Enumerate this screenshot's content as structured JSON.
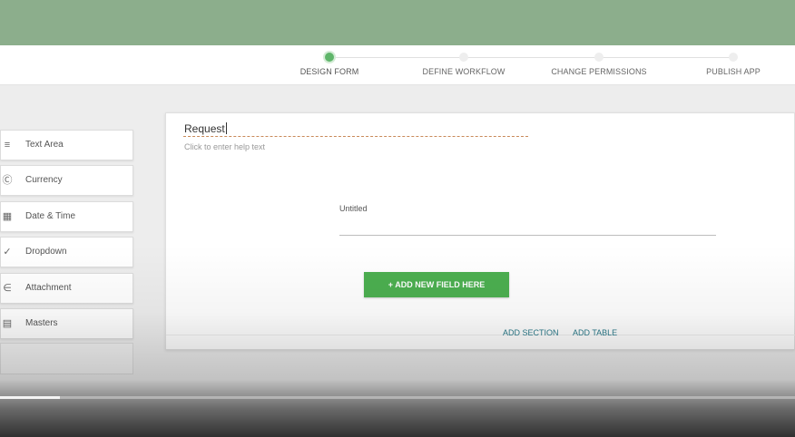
{
  "app": {
    "header_color": "#8cae8c",
    "accent": "#4caf50"
  },
  "stepper": {
    "steps": [
      {
        "label": "DESIGN FORM",
        "active": true
      },
      {
        "label": "DEFINE WORKFLOW",
        "active": false
      },
      {
        "label": "CHANGE PERMISSIONS",
        "active": false
      },
      {
        "label": "PUBLISH APP",
        "active": false
      }
    ]
  },
  "palette": {
    "items": [
      {
        "label": "Text Area",
        "icon": "text-area-icon"
      },
      {
        "label": "Currency",
        "icon": "currency-icon"
      },
      {
        "label": "Date & Time",
        "icon": "calendar-icon"
      },
      {
        "label": "Dropdown",
        "icon": "check-icon"
      },
      {
        "label": "Attachment",
        "icon": "paperclip-icon"
      },
      {
        "label": "Masters",
        "icon": "database-icon"
      }
    ]
  },
  "form": {
    "title": "Request",
    "help_placeholder": "Click to enter help text",
    "field": {
      "label": "Untitled"
    },
    "add_field_label": "+ ADD NEW FIELD HERE",
    "add_section_label": "ADD SECTION",
    "add_table_label": "ADD TABLE"
  },
  "video": {
    "progress": 0.075
  }
}
